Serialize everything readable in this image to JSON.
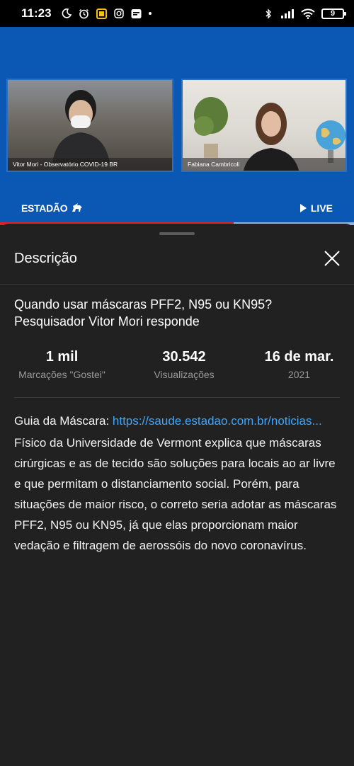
{
  "status_bar": {
    "time": "11:23",
    "battery": "9"
  },
  "video": {
    "left_caption": "Vitor Mori - Observatório COVID-19 BR",
    "right_caption": "Fabiana Cambricoli",
    "brand": "ESTADÃO",
    "live_label": "LIVE",
    "progress": 0.66
  },
  "sheet": {
    "header_title": "Descrição",
    "video_title": "Quando usar máscaras PFF2, N95 ou KN95? Pesquisador Vitor Mori responde",
    "stats": [
      {
        "value": "1 mil",
        "label": "Marcações \"Gostei\""
      },
      {
        "value": "30.542",
        "label": "Visualizações"
      },
      {
        "value": "16 de mar.",
        "label": "2021"
      }
    ],
    "description_prefix": "Guia da Máscara: ",
    "description_link": "https://saude.estadao.com.br/noticias...",
    "description_body": "Físico da Universidade de Vermont explica que máscaras cirúrgicas e as de tecido são soluções para locais ao ar livre e que permitam o distanciamento social. Porém, para situações de maior risco, o correto seria adotar as máscaras PFF2, N95 ou KN95, já que elas proporcionam maior vedação e filtragem de aerossóis do novo coronavírus."
  },
  "colors": {
    "video_bg": "#0b57b4",
    "progress_played": "#e41e26",
    "link": "#3ea6ff",
    "sheet_bg": "#212121"
  }
}
